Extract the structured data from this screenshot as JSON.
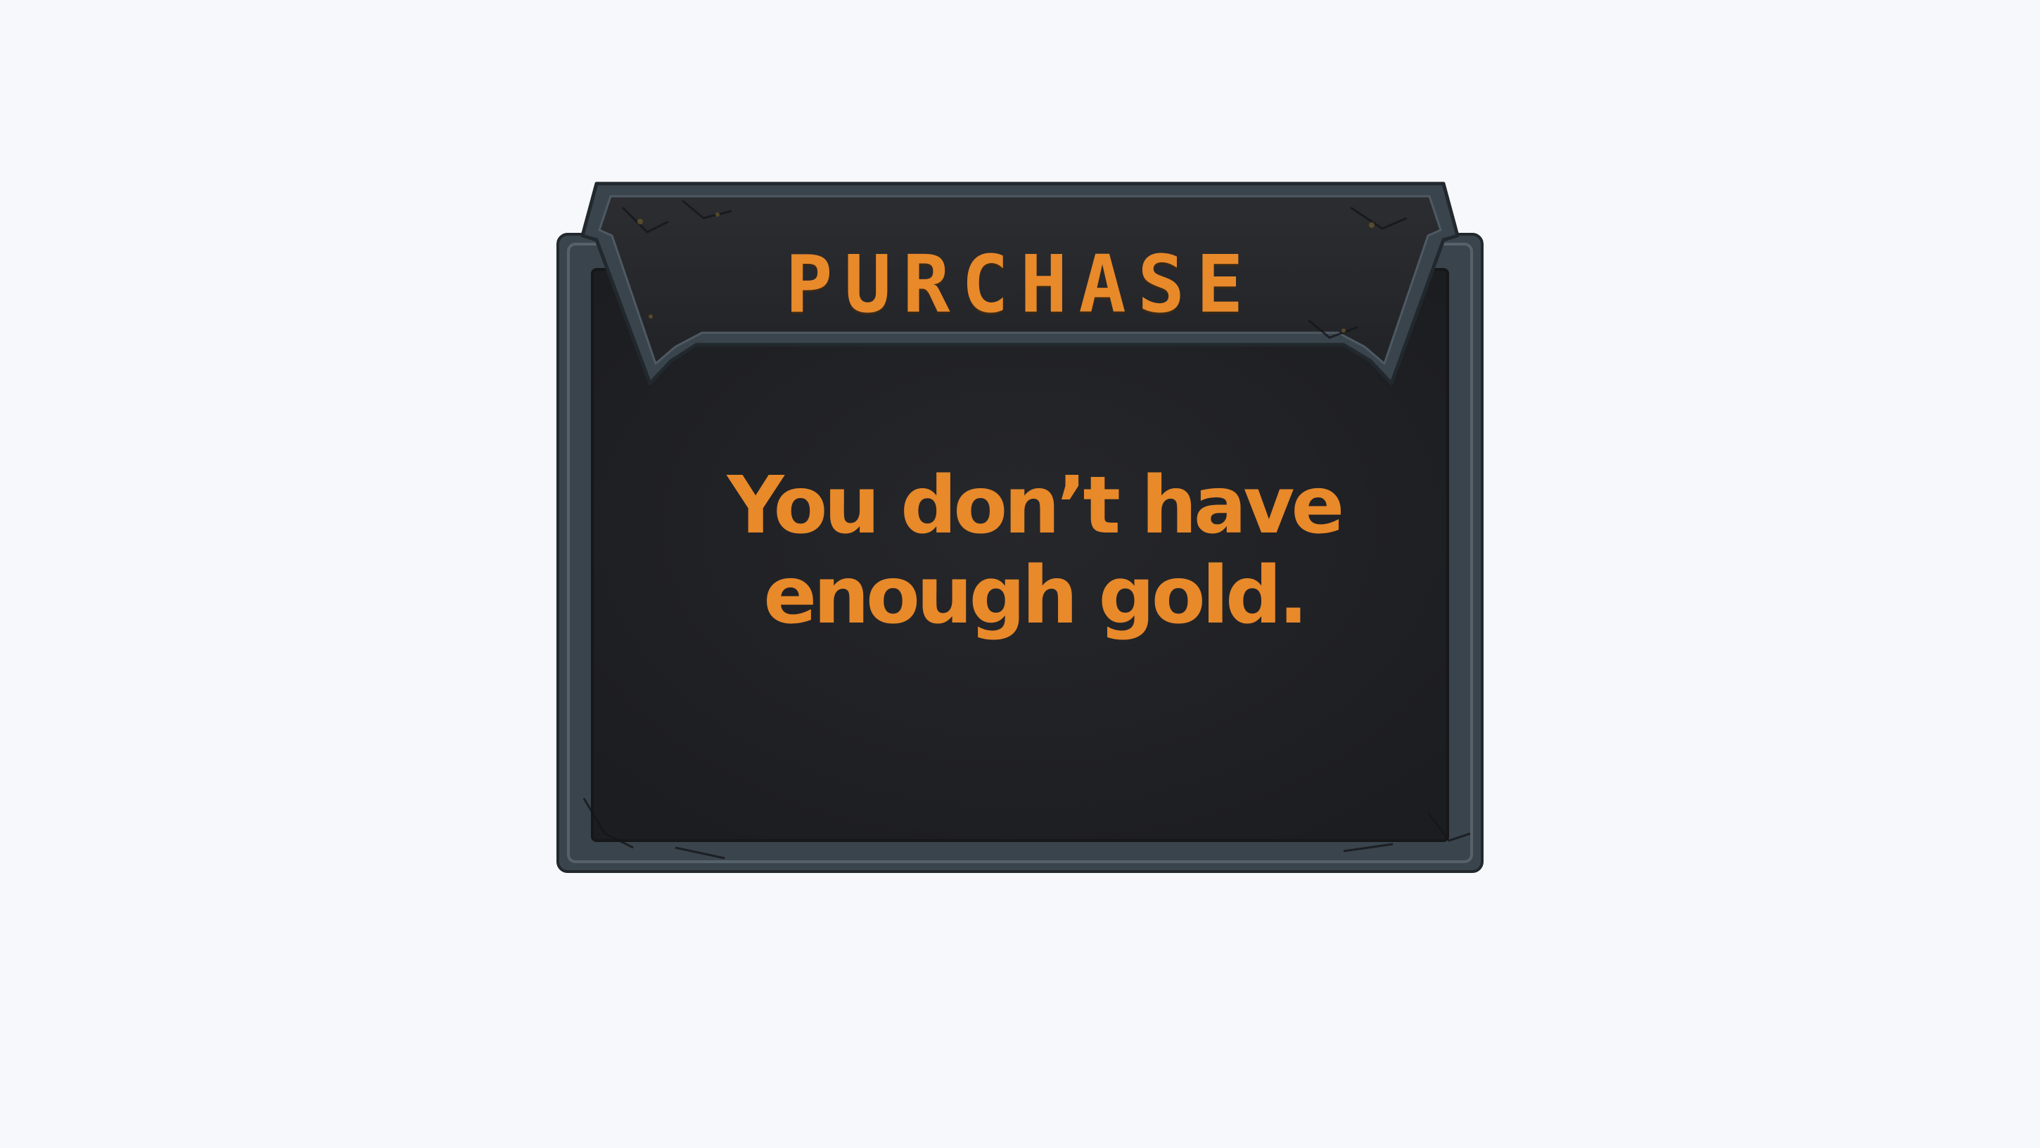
{
  "dialog": {
    "title": "PURCHASE",
    "message": "You don’t have enough gold."
  },
  "colors": {
    "background": "#f7f8fc",
    "panel": "#1f2024",
    "frame": "#3a444c",
    "accent_text": "#e8892a"
  }
}
